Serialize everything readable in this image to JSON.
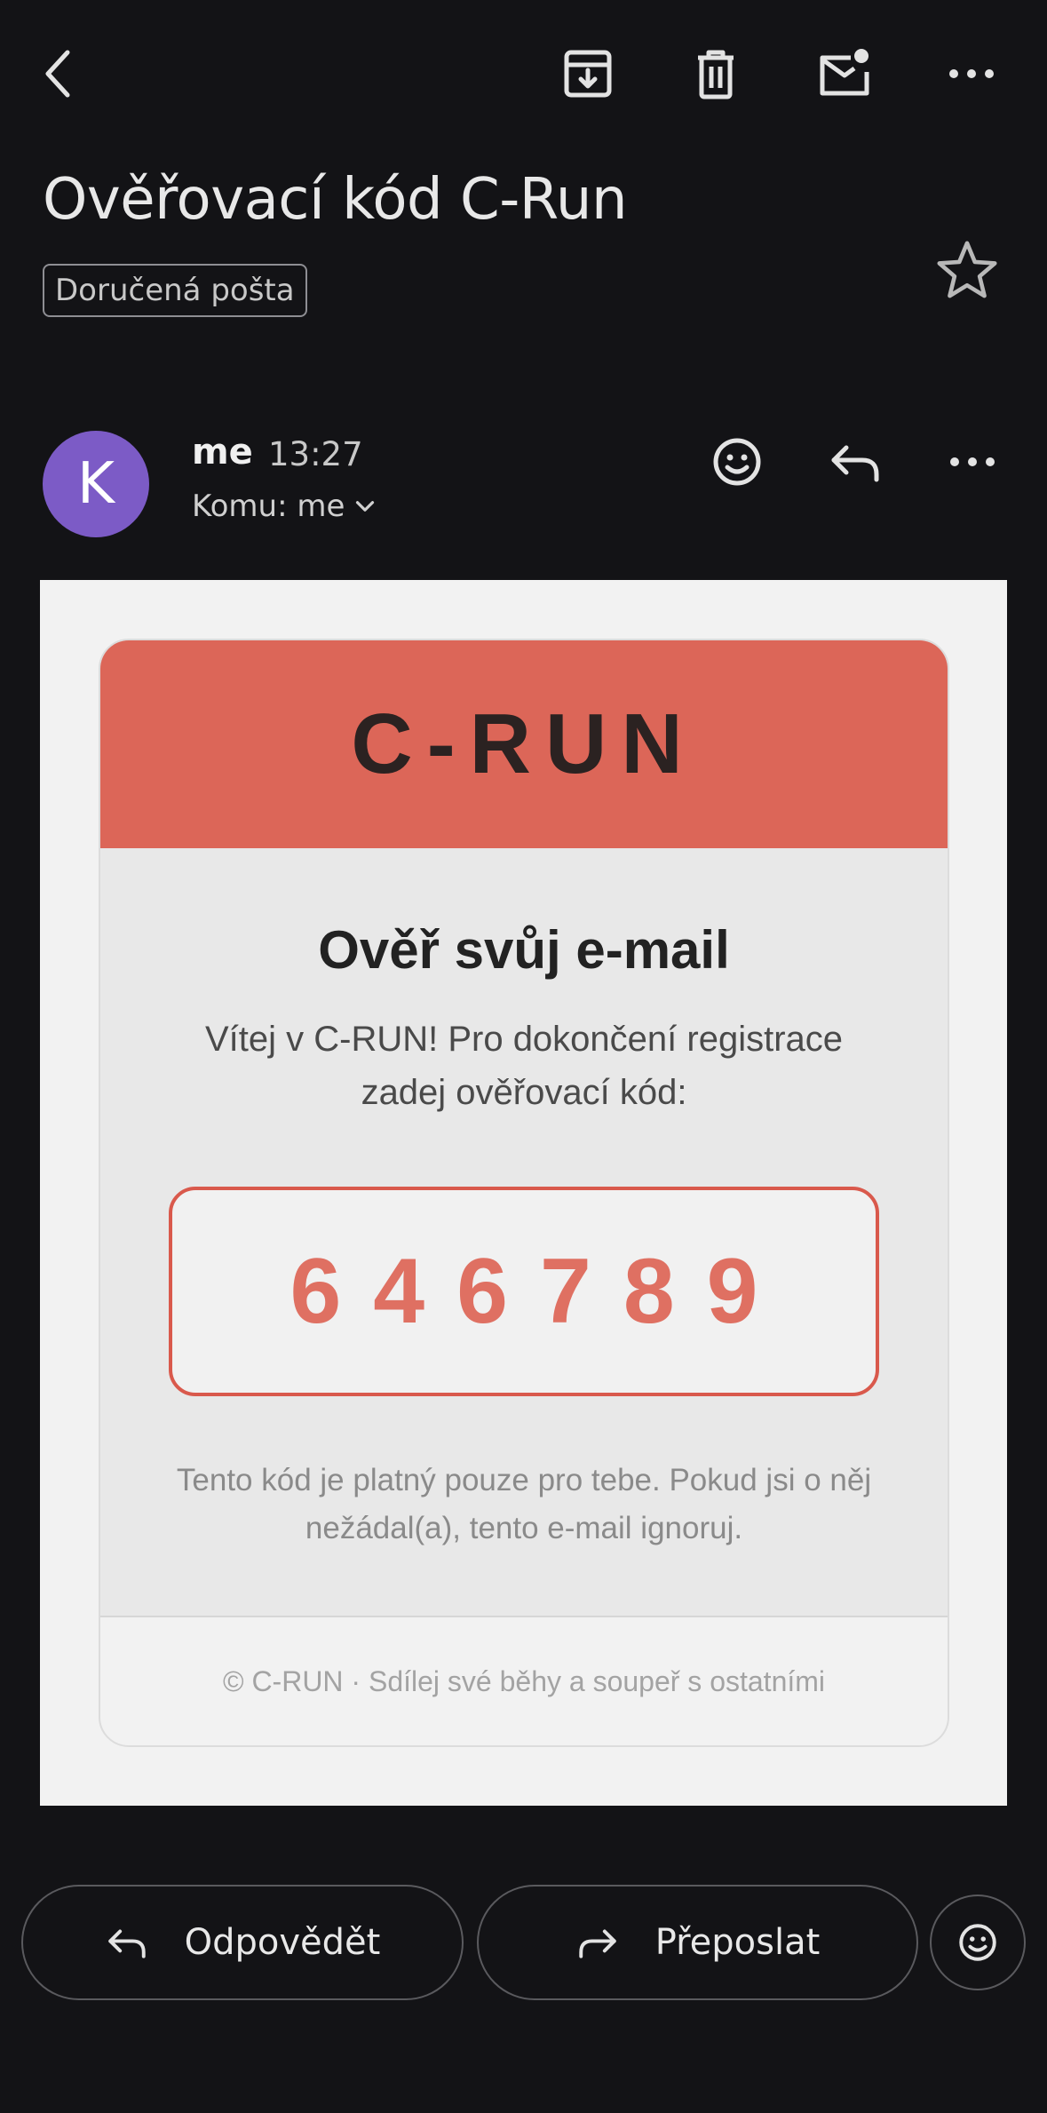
{
  "toolbar": {
    "back_icon": "back-arrow-icon",
    "archive_icon": "archive-icon",
    "delete_icon": "trash-icon",
    "mark_unread_icon": "mark-unread-icon",
    "more_icon": "more-horizontal-icon"
  },
  "email": {
    "subject": "Ověřovací kód C-Run",
    "label": "Doručená pošta",
    "sender_initial": "K",
    "sender_name": "me",
    "time": "13:27",
    "recipient": "Komu: me"
  },
  "message": {
    "brand": "C-RUN",
    "heading": "Ověř svůj e-mail",
    "intro": "Vítej v C-RUN! Pro dokončení registrace zadej ověřovací kód:",
    "code": "646789",
    "note": "Tento kód je platný pouze pro tebe. Pokud jsi o něj nežádal(a), tento e-mail ignoruj.",
    "footer": "© C-RUN · Sdílej své běhy a soupeř s ostatními",
    "accent_color": "#dc6658"
  },
  "actions": {
    "reply": "Odpovědět",
    "forward": "Přeposlat"
  }
}
